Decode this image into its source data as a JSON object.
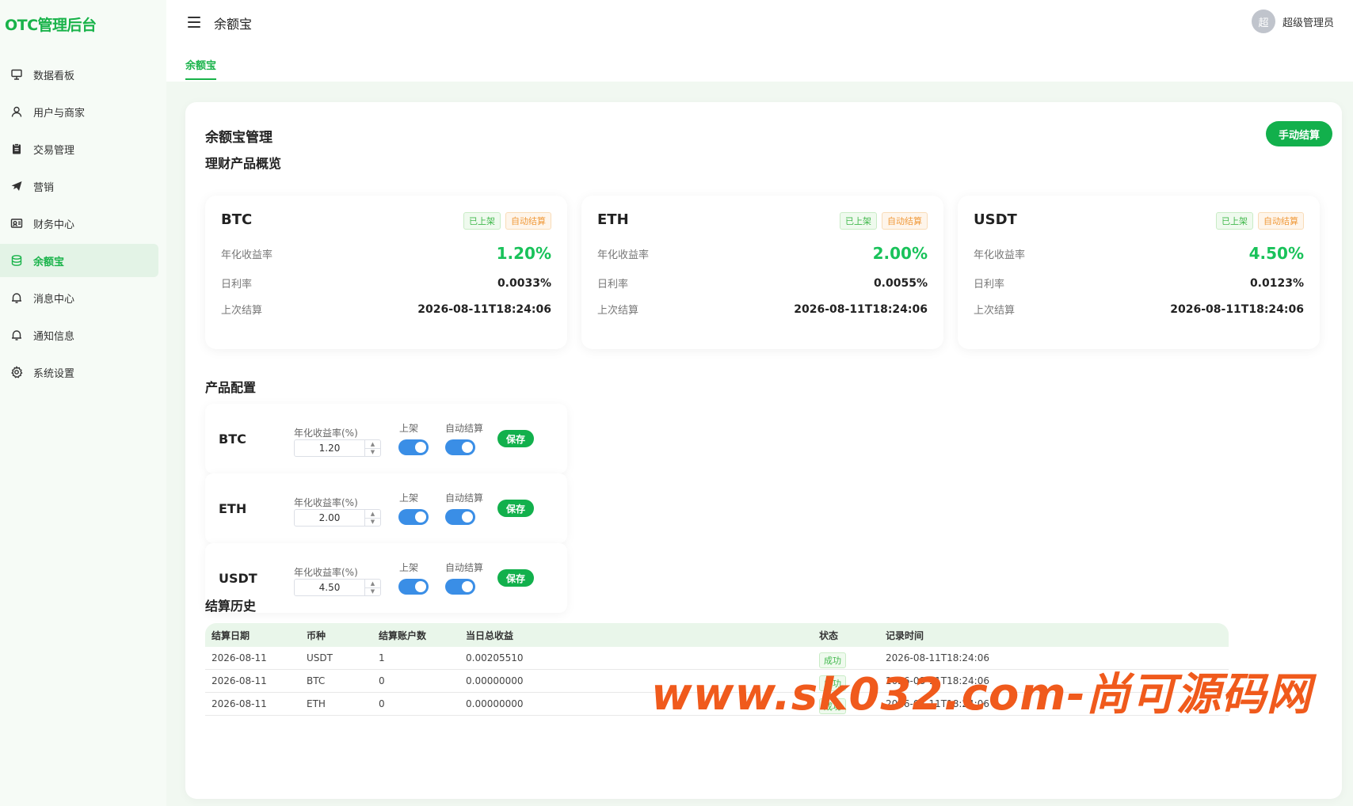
{
  "app": {
    "logo": "OTC管理后台"
  },
  "sidebar": {
    "items": [
      {
        "label": "数据看板",
        "icon": "dashboard-icon"
      },
      {
        "label": "用户与商家",
        "icon": "user-icon"
      },
      {
        "label": "交易管理",
        "icon": "clipboard-icon"
      },
      {
        "label": "营销",
        "icon": "send-icon"
      },
      {
        "label": "财务中心",
        "icon": "finance-icon"
      },
      {
        "label": "余额宝",
        "icon": "coins-icon",
        "active": true
      },
      {
        "label": "消息中心",
        "icon": "bell-icon"
      },
      {
        "label": "通知信息",
        "icon": "bell-icon"
      },
      {
        "label": "系统设置",
        "icon": "gear-icon"
      }
    ]
  },
  "header": {
    "title": "余额宝",
    "avatar_text": "超",
    "username": "超级管理员"
  },
  "tabs": [
    {
      "label": "余额宝",
      "active": true
    }
  ],
  "main": {
    "title": "余额宝管理",
    "settle_button": "手动结算"
  },
  "overview": {
    "title": "理财产品概览",
    "labels": {
      "annual": "年化收益率",
      "daily": "日利率",
      "last": "上次结算"
    },
    "cards": [
      {
        "name": "BTC",
        "badge_listed": "已上架",
        "badge_auto": "自动结算",
        "annual_rate": "1.20%",
        "daily_rate": "0.0033%",
        "last_settle": "2026-08-11T18:24:06"
      },
      {
        "name": "ETH",
        "badge_listed": "已上架",
        "badge_auto": "自动结算",
        "annual_rate": "2.00%",
        "daily_rate": "0.0055%",
        "last_settle": "2026-08-11T18:24:06"
      },
      {
        "name": "USDT",
        "badge_listed": "已上架",
        "badge_auto": "自动结算",
        "annual_rate": "4.50%",
        "daily_rate": "0.0123%",
        "last_settle": "2026-08-11T18:24:06"
      }
    ]
  },
  "config": {
    "title": "产品配置",
    "labels": {
      "rate": "年化收益率(%)",
      "listed": "上架",
      "auto": "自动结算",
      "save": "保存"
    },
    "rows": [
      {
        "name": "BTC",
        "rate": "1.20",
        "listed": true,
        "auto": true
      },
      {
        "name": "ETH",
        "rate": "2.00",
        "listed": true,
        "auto": true
      },
      {
        "name": "USDT",
        "rate": "4.50",
        "listed": true,
        "auto": true
      }
    ]
  },
  "history": {
    "title": "结算历史",
    "columns": [
      "结算日期",
      "币种",
      "结算账户数",
      "当日总收益",
      "状态",
      "记录时间"
    ],
    "rows": [
      [
        "2026-08-11",
        "USDT",
        "1",
        "0.00205510",
        "成功",
        "2026-08-11T18:24:06"
      ],
      [
        "2026-08-11",
        "BTC",
        "0",
        "0.00000000",
        "成功",
        "2026-08-11T18:24:06"
      ],
      [
        "2026-08-11",
        "ETH",
        "0",
        "0.00000000",
        "成功",
        "2026-08-11T18:24:06"
      ]
    ]
  },
  "watermark": "www.sk032.com-尚可源码网",
  "colors": {
    "accent": "#19b34a",
    "switch": "#3a8ee6",
    "tag_orange": "#f09a3b",
    "watermark": "#f05a1c"
  }
}
